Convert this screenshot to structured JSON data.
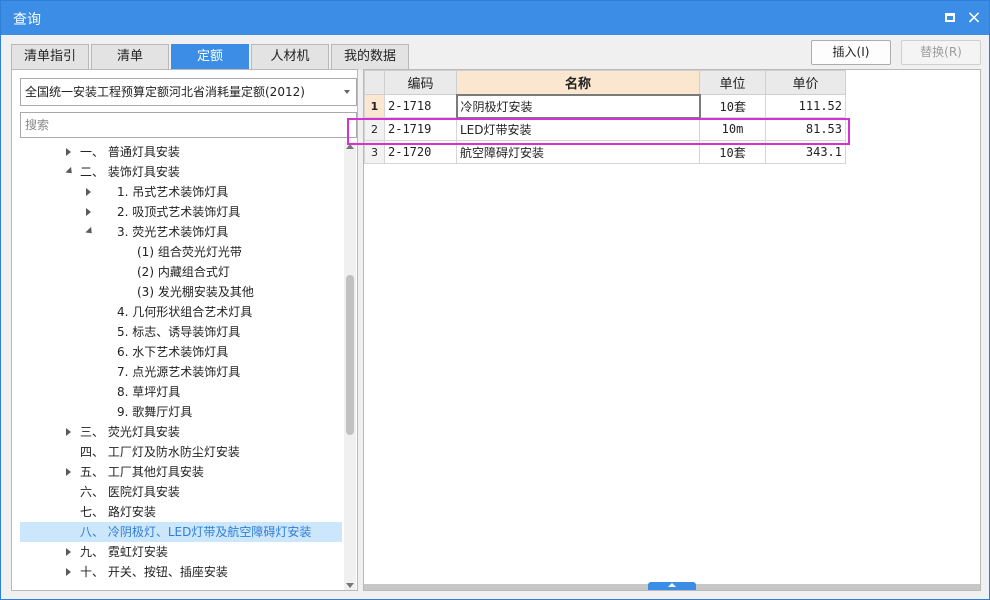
{
  "window": {
    "title": "查询",
    "maximize_icon": "maximize-icon",
    "close_label": "×"
  },
  "tabs": [
    {
      "label": "清单指引",
      "active": false
    },
    {
      "label": "清单",
      "active": false
    },
    {
      "label": "定额",
      "active": true
    },
    {
      "label": "人材机",
      "active": false
    },
    {
      "label": "我的数据",
      "active": false
    }
  ],
  "toolbar": {
    "insert_label": "插入(I)",
    "replace_label": "替换(R)"
  },
  "left": {
    "quota_select": "全国统一安装工程预算定额河北省消耗量定额(2012)",
    "search_placeholder": "搜索",
    "tree": [
      {
        "label": "一、 普通灯具安装",
        "expander": "collapsed"
      },
      {
        "label": "二、 装饰灯具安装",
        "expander": "expanded"
      },
      {
        "label": "1. 吊式艺术装饰灯具",
        "expander": "collapsed"
      },
      {
        "label": "2. 吸顶式艺术装饰灯具",
        "expander": "collapsed"
      },
      {
        "label": "3. 荧光艺术装饰灯具",
        "expander": "expanded"
      },
      {
        "label": "(1) 组合荧光灯光带",
        "expander": "none"
      },
      {
        "label": "(2) 内藏组合式灯",
        "expander": "none"
      },
      {
        "label": "(3) 发光棚安装及其他",
        "expander": "none"
      },
      {
        "label": "4. 几何形状组合艺术灯具",
        "expander": "none"
      },
      {
        "label": "5. 标志、诱导装饰灯具",
        "expander": "none"
      },
      {
        "label": "6. 水下艺术装饰灯具",
        "expander": "none"
      },
      {
        "label": "7. 点光源艺术装饰灯具",
        "expander": "none"
      },
      {
        "label": "8. 草坪灯具",
        "expander": "none"
      },
      {
        "label": "9. 歌舞厅灯具",
        "expander": "none"
      },
      {
        "label": "三、 荧光灯具安装",
        "expander": "collapsed"
      },
      {
        "label": "四、 工厂灯及防水防尘灯安装",
        "expander": "none"
      },
      {
        "label": "五、 工厂其他灯具安装",
        "expander": "collapsed"
      },
      {
        "label": "六、 医院灯具安装",
        "expander": "none"
      },
      {
        "label": "七、 路灯安装",
        "expander": "none"
      },
      {
        "label": "八、 冷阴极灯、LED灯带及航空障碍灯安装",
        "expander": "none",
        "selected": true
      },
      {
        "label": "九、 霓虹灯安装",
        "expander": "collapsed"
      },
      {
        "label": "十、 开关、按钮、插座安装",
        "expander": "collapsed"
      }
    ]
  },
  "grid": {
    "columns": [
      "编码",
      "名称",
      "单位",
      "单价"
    ],
    "rows": [
      {
        "index": "1",
        "code": "2-1718",
        "name": "冷阴极灯安装",
        "unit": "10套",
        "price": "111.52"
      },
      {
        "index": "2",
        "code": "2-1719",
        "name": "LED灯带安装",
        "unit": "10m",
        "price": "81.53"
      },
      {
        "index": "3",
        "code": "2-1720",
        "name": "航空障碍灯安装",
        "unit": "10套",
        "price": "343.1"
      }
    ]
  },
  "colors": {
    "accent": "#3c8de5",
    "highlight_box": "#d533d1",
    "selected_row": "#cce6fb"
  }
}
